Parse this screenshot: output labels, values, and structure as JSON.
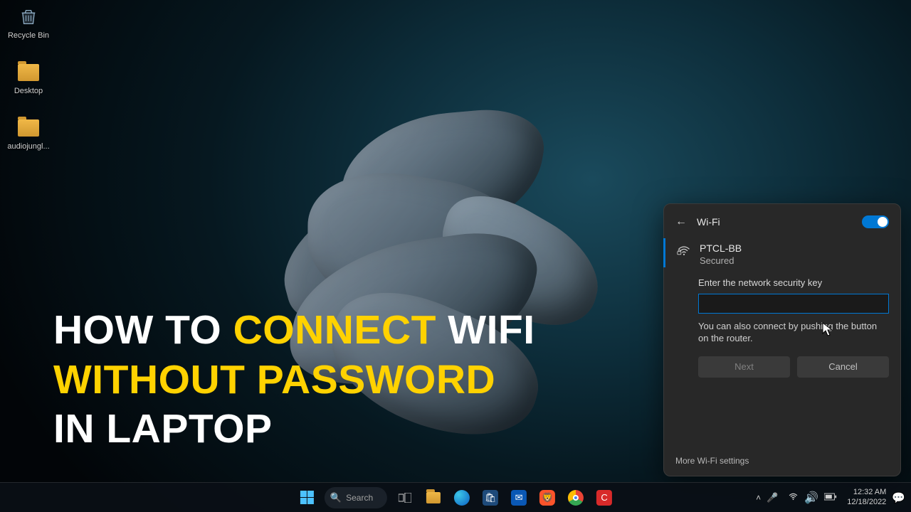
{
  "desktop": {
    "icons": [
      {
        "label": "Recycle Bin",
        "type": "recycle"
      },
      {
        "label": "Desktop",
        "type": "folder"
      },
      {
        "label": "audiojungl...",
        "type": "folder"
      }
    ]
  },
  "overlay": {
    "l1a": "HOW TO ",
    "l1b": "CONNECT",
    "l1c": " WIFI",
    "l2a": "WITHOUT PASSWORD",
    "l3a": "IN LAPTOP"
  },
  "wifi": {
    "title": "Wi-Fi",
    "network_name": "PTCL-BB",
    "network_status": "Secured",
    "prompt": "Enter the network security key",
    "input_value": "",
    "wps_hint": "You can also connect by pushing the button on the router.",
    "next": "Next",
    "cancel": "Cancel",
    "more": "More Wi-Fi settings"
  },
  "taskbar": {
    "search": "Search",
    "time": "12:32 AM",
    "date": "12/18/2022"
  }
}
